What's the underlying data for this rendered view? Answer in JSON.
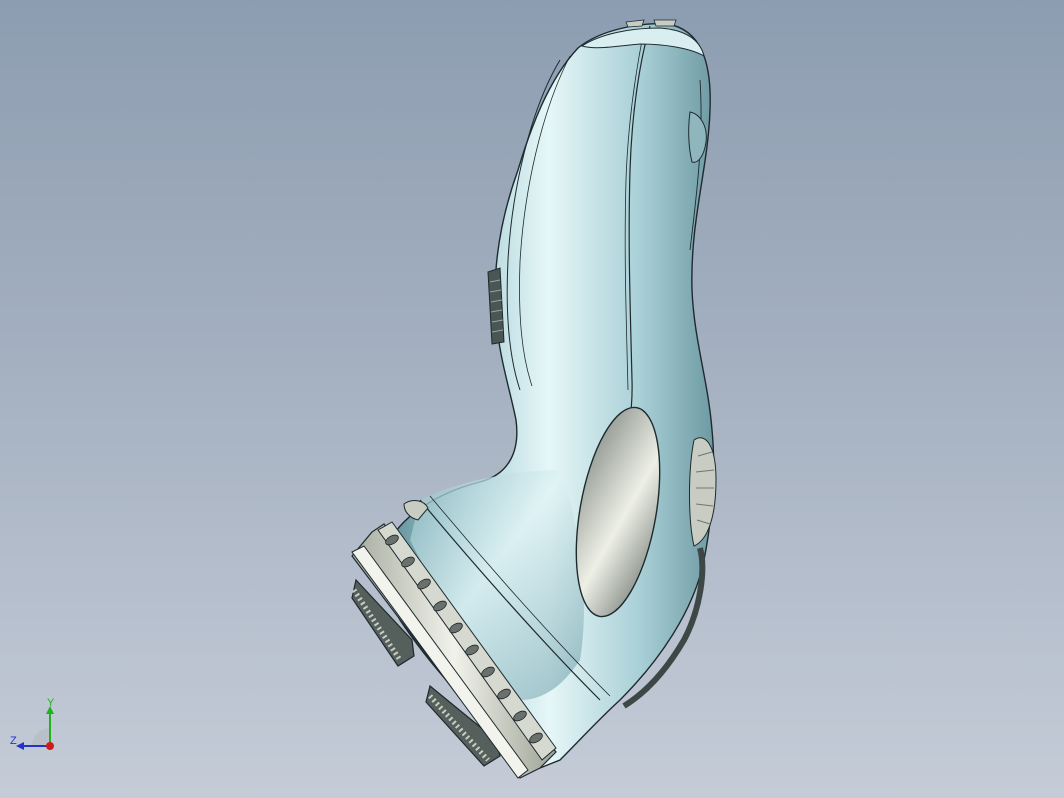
{
  "model_view": {
    "object": "shaver",
    "render_style": "shaded-with-edges",
    "colors": {
      "background_top": "#8d9db1",
      "background_bottom": "#c5ccd8",
      "body": "#a8cfd6",
      "body_highlight": "#e6f7f8",
      "body_shadow": "#5e8c96",
      "edge": "#1e2a2e",
      "metal": "#c9ccc2",
      "dark_part": "#4a5654"
    }
  },
  "triad": {
    "y_label": "Y",
    "z_label": "Z",
    "colors": {
      "y": "#1db31d",
      "z": "#2233cc",
      "x": "#d11a1a"
    }
  }
}
